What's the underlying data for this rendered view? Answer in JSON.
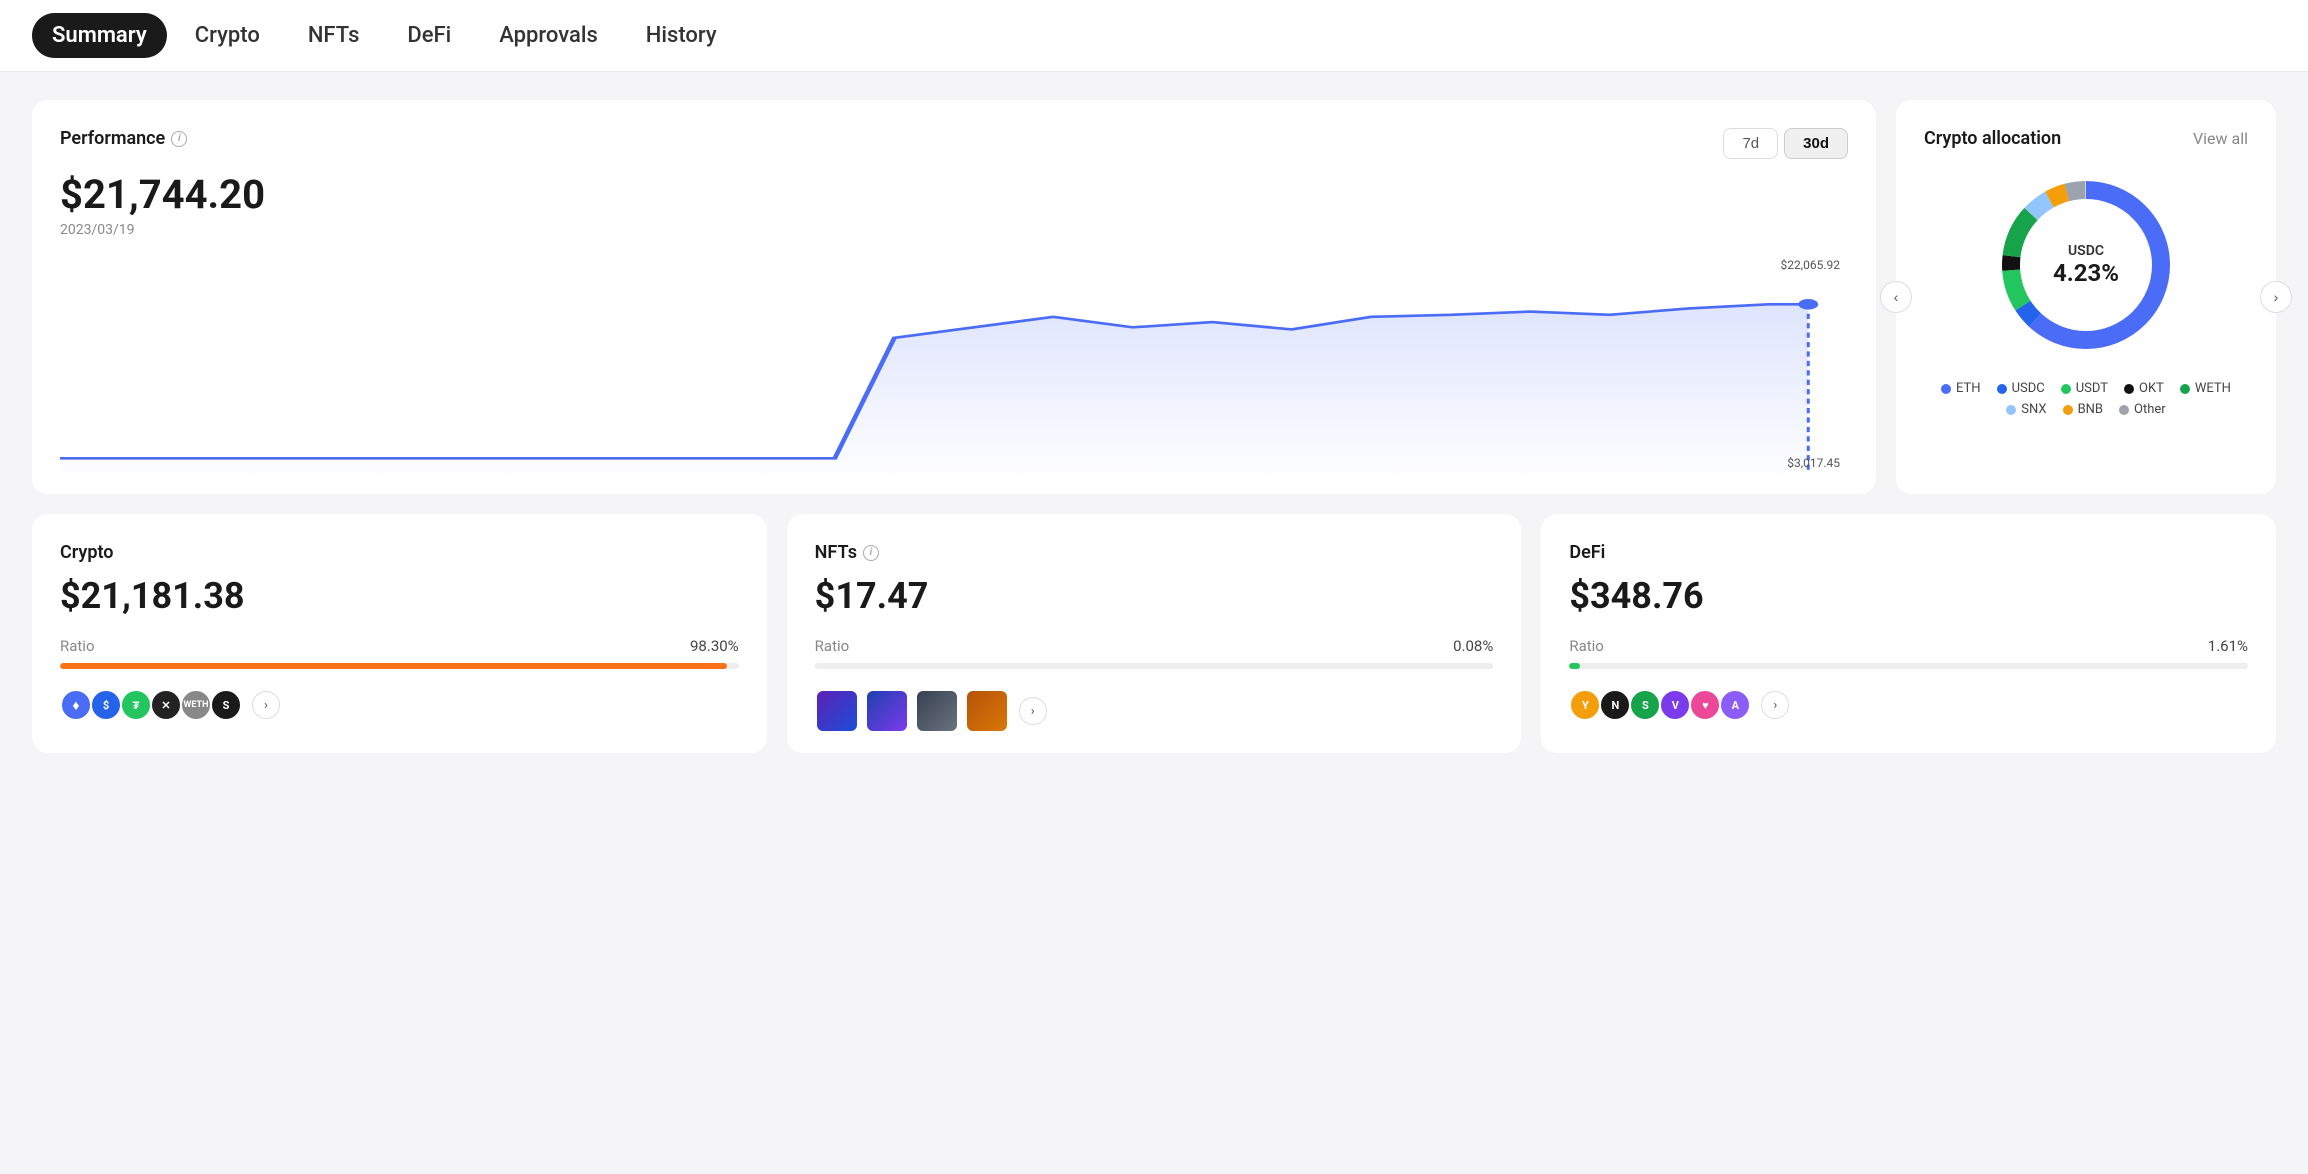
{
  "nav": {
    "items": [
      {
        "label": "Summary",
        "active": true
      },
      {
        "label": "Crypto",
        "active": false
      },
      {
        "label": "NFTs",
        "active": false
      },
      {
        "label": "DeFi",
        "active": false
      },
      {
        "label": "Approvals",
        "active": false
      },
      {
        "label": "History",
        "active": false
      }
    ]
  },
  "performance": {
    "title": "Performance",
    "amount": "$21,744.20",
    "date": "2023/03/19",
    "high_label": "$22,065.92",
    "low_label": "$3,017.45",
    "time_buttons": [
      {
        "label": "7d",
        "active": false
      },
      {
        "label": "30d",
        "active": true
      }
    ]
  },
  "allocation": {
    "title": "Crypto allocation",
    "view_all": "View all",
    "center_label": "USDC",
    "center_pct": "4.23%",
    "legend": [
      {
        "label": "ETH",
        "color": "#4a6cf7"
      },
      {
        "label": "USDC",
        "color": "#2563eb"
      },
      {
        "label": "USDT",
        "color": "#22c55e"
      },
      {
        "label": "OKT",
        "color": "#111"
      },
      {
        "label": "WETH",
        "color": "#16a34a"
      },
      {
        "label": "SNX",
        "color": "#93c5fd"
      },
      {
        "label": "BNB",
        "color": "#f59e0b"
      },
      {
        "label": "Other",
        "color": "#9ca3af"
      }
    ],
    "segments": [
      {
        "pct": 62,
        "color": "#4a6cf7"
      },
      {
        "pct": 4,
        "color": "#2563eb"
      },
      {
        "pct": 8,
        "color": "#22c55e"
      },
      {
        "pct": 3,
        "color": "#111"
      },
      {
        "pct": 10,
        "color": "#16a34a"
      },
      {
        "pct": 5,
        "color": "#93c5fd"
      },
      {
        "pct": 4,
        "color": "#f59e0b"
      },
      {
        "pct": 4,
        "color": "#9ca3af"
      }
    ]
  },
  "cards": {
    "crypto": {
      "title": "Crypto",
      "amount": "$21,181.38",
      "ratio_label": "Ratio",
      "ratio_pct": "98.30%",
      "bar_color": "#f97316",
      "bar_width": "98.3"
    },
    "nfts": {
      "title": "NFTs",
      "amount": "$17.47",
      "ratio_label": "Ratio",
      "ratio_pct": "0.08%",
      "bar_color": "#e5e7eb",
      "bar_width": "0.08"
    },
    "defi": {
      "title": "DeFi",
      "amount": "$348.76",
      "ratio_label": "Ratio",
      "ratio_pct": "1.61%",
      "bar_color": "#22c55e",
      "bar_width": "1.61"
    }
  },
  "icons": {
    "info": "i",
    "chevron_right": "›",
    "chevron_left": "‹"
  }
}
